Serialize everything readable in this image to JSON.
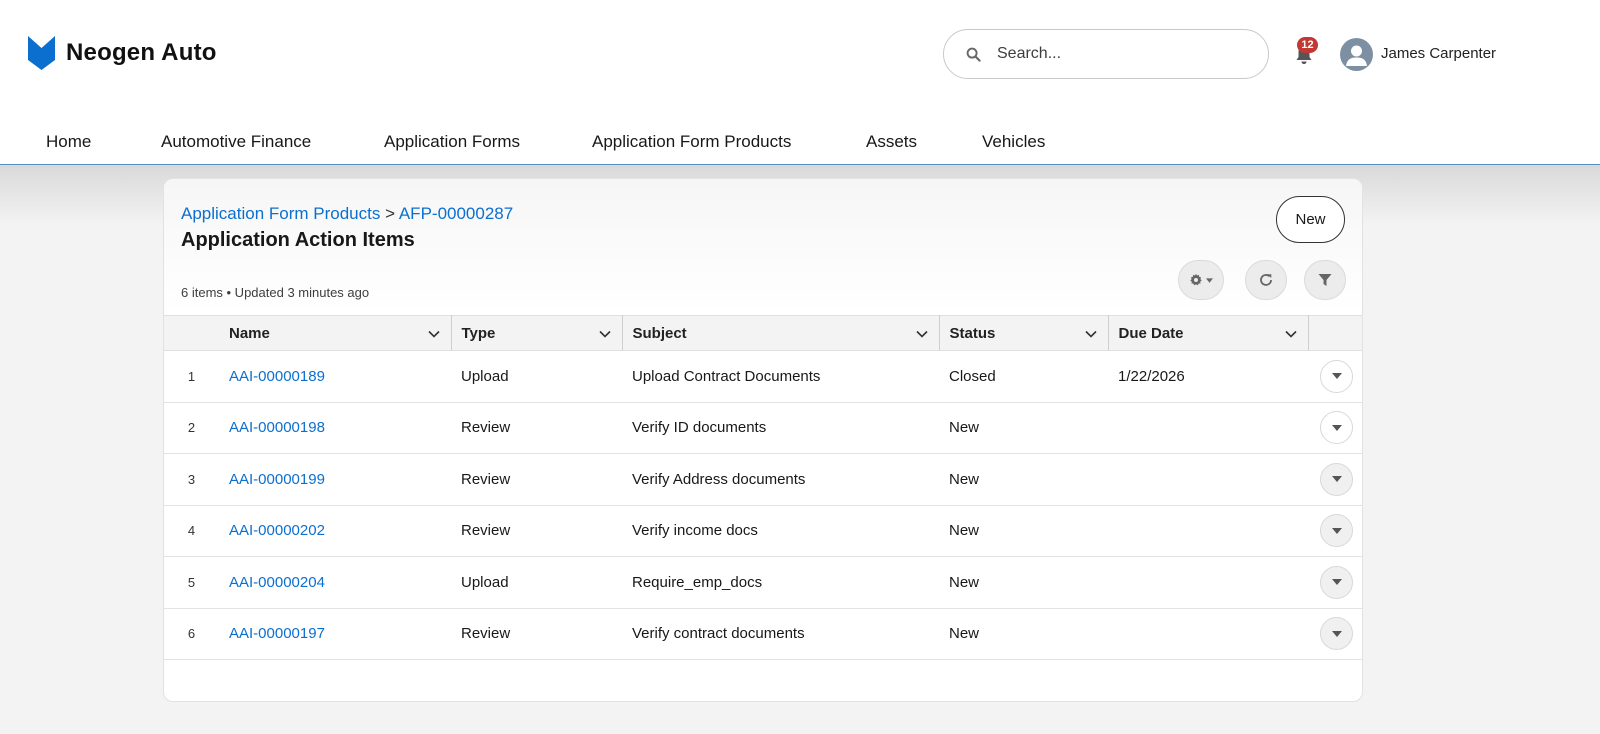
{
  "app": {
    "name": "Neogen Auto",
    "brand_color": "#0b6fd0"
  },
  "header": {
    "search_placeholder": "Search...",
    "notification_count": "12",
    "user_name": "James Carpenter"
  },
  "nav": {
    "items": [
      {
        "label": "Home"
      },
      {
        "label": "Automotive Finance"
      },
      {
        "label": "Application Forms"
      },
      {
        "label": "Application Form Products"
      },
      {
        "label": "Assets"
      },
      {
        "label": "Vehicles"
      }
    ]
  },
  "list": {
    "breadcrumb_parent": "Application Form Products",
    "breadcrumb_separator": ">",
    "breadcrumb_record": "AFP-00000287",
    "title": "Application Action Items",
    "meta": "6 items • Updated 3 minutes ago",
    "new_button": "New",
    "columns": [
      "Name",
      "Type",
      "Subject",
      "Status",
      "Due Date"
    ],
    "rows": [
      {
        "num": "1",
        "name": "AAI-00000189",
        "type": "Upload",
        "subject": "Upload Contract Documents",
        "status": "Closed",
        "due": "1/22/2026"
      },
      {
        "num": "2",
        "name": "AAI-00000198",
        "type": "Review",
        "subject": "Verify ID documents",
        "status": "New",
        "due": ""
      },
      {
        "num": "3",
        "name": "AAI-00000199",
        "type": "Review",
        "subject": "Verify Address documents",
        "status": "New",
        "due": ""
      },
      {
        "num": "4",
        "name": "AAI-00000202",
        "type": "Review",
        "subject": "Verify income docs",
        "status": "New",
        "due": ""
      },
      {
        "num": "5",
        "name": "AAI-00000204",
        "type": "Upload",
        "subject": "Require_emp_docs",
        "status": "New",
        "due": ""
      },
      {
        "num": "6",
        "name": "AAI-00000197",
        "type": "Review",
        "subject": "Verify contract documents",
        "status": "New",
        "due": ""
      }
    ]
  }
}
